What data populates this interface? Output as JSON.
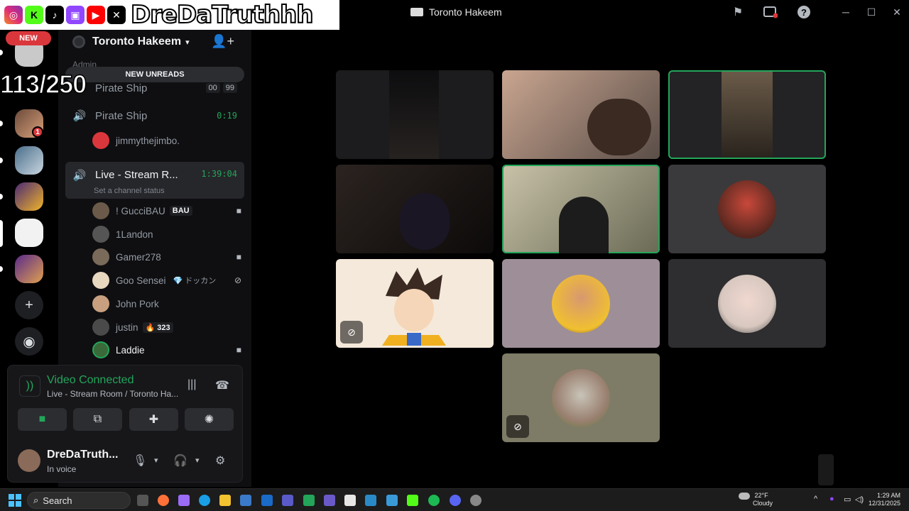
{
  "window": {
    "title": "Toronto Hakeem",
    "controls": [
      "─",
      "☐",
      "✕"
    ]
  },
  "overlay": {
    "handle": "DreDaTruthhh",
    "socials": [
      "instagram-icon",
      "kick-icon",
      "tiktok-icon",
      "twitch-icon",
      "youtube-icon",
      "x-icon"
    ],
    "counter": "113/250"
  },
  "rail": {
    "new_label": "NEW",
    "badge_count": "1"
  },
  "server": {
    "name": "Toronto Hakeem",
    "admin_category": "Admin",
    "new_unreads": "NEW UNREADS"
  },
  "channels": [
    {
      "name": "Pirate Ship",
      "nums": [
        "00",
        "99"
      ]
    },
    {
      "name": "Pirate Ship",
      "time": "0:19"
    },
    {
      "name": "Live - Stream R...",
      "time": "1:39:04",
      "status": "Set a channel status"
    }
  ],
  "pirate_member": "jimmythejimbo.",
  "members": [
    {
      "name": "! GucciBAU",
      "tag": "BAU",
      "icon": "video"
    },
    {
      "name": "1Landon"
    },
    {
      "name": "Gamer278",
      "icon": "video"
    },
    {
      "name": "Goo Sensei",
      "tag": "💎 ドッカン",
      "icon": "deafened"
    },
    {
      "name": "John Pork"
    },
    {
      "name": "justin",
      "tag": "🔥 323"
    },
    {
      "name": "Laddie",
      "icon": "video"
    }
  ],
  "voice": {
    "status": "Video Connected",
    "channel": "Live - Stream Room / Toronto Ha..."
  },
  "user": {
    "name": "DreDaTruth...",
    "status": "In voice"
  },
  "taskbar": {
    "search": "Search",
    "weather_temp": "22°F",
    "weather_desc": "Cloudy",
    "time": "1:29 AM",
    "date": "12/31/2025"
  },
  "colors": {
    "accent_green": "#23a55a",
    "danger": "#da373c",
    "sidebar_bg": "#0f0f11"
  }
}
